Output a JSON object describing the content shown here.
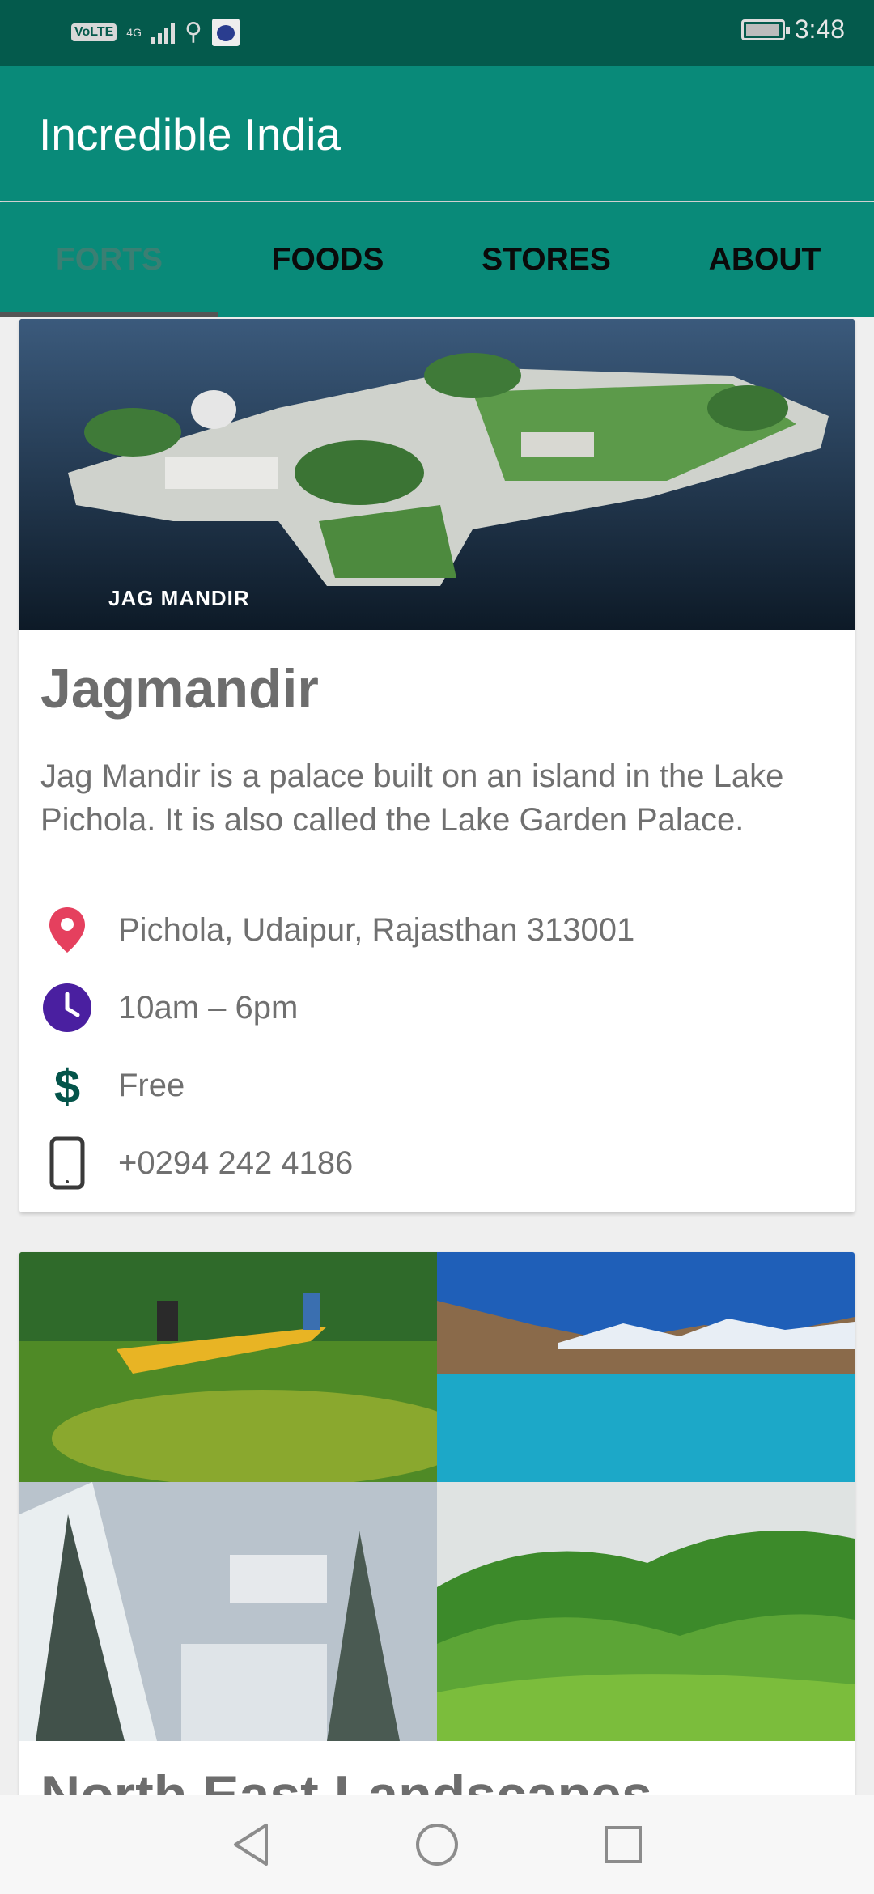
{
  "status_bar": {
    "volte": "VoLTE",
    "network": "4G",
    "time": "3:48",
    "icons": [
      "volte-icon",
      "signal-icon",
      "usb-icon",
      "notification-icon",
      "battery-icon"
    ]
  },
  "app_bar": {
    "title": "Incredible India"
  },
  "tabs": [
    {
      "label": "FORTS",
      "active": true
    },
    {
      "label": "FOODS",
      "active": false
    },
    {
      "label": "STORES",
      "active": false
    },
    {
      "label": "ABOUT",
      "active": false
    }
  ],
  "cards": [
    {
      "image_caption": "JAG MANDIR",
      "title": "Jagmandir",
      "description": "Jag Mandir is a palace built on an island in the Lake Pichola. It is also called the Lake Garden Palace.",
      "address": "Pichola, Udaipur, Rajasthan 313001",
      "hours": "10am – 6pm",
      "fee": "Free",
      "phone": "+0294 242 4186"
    },
    {
      "title": "North East Landscapes"
    }
  ],
  "colors": {
    "status_bar": "#045a4c",
    "primary": "#098a79",
    "location_icon": "#e5405e",
    "clock_icon": "#4a1fa0",
    "dollar_icon": "#04544a",
    "phone_icon": "#3a3a3a"
  },
  "nav_bar": {
    "icons": [
      "back-icon",
      "home-icon",
      "recents-icon"
    ]
  }
}
